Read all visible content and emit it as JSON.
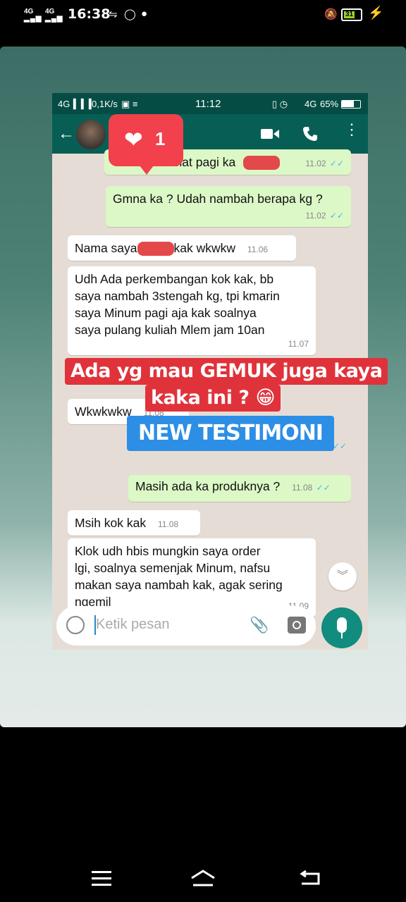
{
  "outer_status": {
    "sig1": "4G",
    "sig2": "4G",
    "time": "16:38",
    "battery": "31",
    "colors": {
      "battery_fill": "#9cd12b",
      "charging": "#f7d21e"
    }
  },
  "story": {
    "like_count": "1",
    "heart_icon": "heart-icon",
    "overlay_line1": "Ada yg mau GEMUK juga kaya",
    "overlay_line2": "kaka ini ? 😁",
    "new_testimoni": "NEW TESTIMONI"
  },
  "screenshot": {
    "status": {
      "network": "4G",
      "speed": "0,1K/s",
      "time": "11:12",
      "net2": "4G",
      "battery": "65%"
    },
    "messages": [
      {
        "dir": "out",
        "text": "amat pagi ka",
        "time": "11.02"
      },
      {
        "dir": "out",
        "text": "Gmna ka ? Udah nambah berapa kg ?",
        "time": "11.02"
      },
      {
        "dir": "in",
        "text_before": "Nama saya",
        "text_after": "kak wkwkw",
        "time": "11.06"
      },
      {
        "dir": "in",
        "lines": [
          "Udh Ada perkembangan kok kak, bb",
          "saya nambah 3stengah kg, tpi kmarin",
          "saya Minum pagi aja kak soalnya",
          "saya pulang kuliah Mlem jam 10an"
        ],
        "time": "11.07"
      },
      {
        "dir": "in",
        "text": "Wkwkwkw",
        "time": "11.08"
      },
      {
        "dir": "out",
        "text": "Masih ada ka produknya ?",
        "time": "11.08"
      },
      {
        "dir": "in",
        "text": "Msih kok kak",
        "time": "11.08"
      },
      {
        "dir": "in",
        "lines": [
          "Klok udh hbis mungkin saya order",
          "lgi, soalnya semenjak Minum, nafsu",
          "makan saya nambah kak, agak sering",
          "ngemil"
        ],
        "time": "11.09"
      }
    ],
    "input_placeholder": "Ketik pesan"
  }
}
